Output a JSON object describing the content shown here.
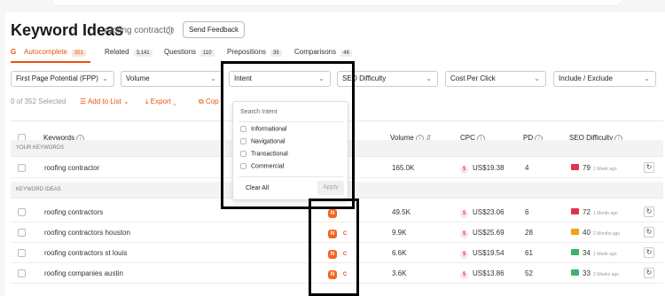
{
  "header": {
    "title": "Keyword Ideas",
    "subtitle": "roofing contractor",
    "feedback_label": "Send Feedback"
  },
  "tabs": [
    {
      "label": "Autocomplete",
      "count": "351"
    },
    {
      "label": "Related",
      "count": "3,141"
    },
    {
      "label": "Questions",
      "count": "110"
    },
    {
      "label": "Prepositions",
      "count": "35"
    },
    {
      "label": "Comparisons",
      "count": "46"
    }
  ],
  "filters": {
    "fpp": "First Page Potential (FPP)",
    "volume": "Volume",
    "intent": "Intent",
    "seo": "SEO Difficulty",
    "cpc": "Cost Per Click",
    "include": "Include / Exclude"
  },
  "actions": {
    "selected": "0 of 352 Selected",
    "add": "Add to List",
    "export": "Export",
    "copy": "Cop"
  },
  "table": {
    "headers": {
      "keywords": "Keywords",
      "volume": "Volume",
      "cpc": "CPC",
      "pd": "PD",
      "seo": "SEO Difficulty"
    },
    "your_keywords_label": "YOUR KEYWORDS",
    "keyword_ideas_label": "KEYWORD IDEAS",
    "your_rows": [
      {
        "keyword": "roofing contractor",
        "volume": "165.0K",
        "cpc": "US$19.38",
        "pd": "4",
        "seo": "79",
        "ago": "1 Week ago",
        "seo_color": "#e0334f"
      }
    ],
    "idea_rows": [
      {
        "keyword": "roofing contractors",
        "intent": [
          "N"
        ],
        "volume": "49.5K",
        "cpc": "US$23.06",
        "pd": "6",
        "seo": "72",
        "ago": "1 Month ago",
        "seo_color": "#e0334f"
      },
      {
        "keyword": "roofing contractors houston",
        "intent": [
          "N",
          "C"
        ],
        "volume": "9.9K",
        "cpc": "US$25.69",
        "pd": "28",
        "seo": "40",
        "ago": "2 Months ago",
        "seo_color": "#f2a20c"
      },
      {
        "keyword": "roofing contractors st louis",
        "intent": [
          "N",
          "C"
        ],
        "volume": "6.6K",
        "cpc": "US$19.54",
        "pd": "61",
        "seo": "34",
        "ago": "1 Week ago",
        "seo_color": "#3bb36b"
      },
      {
        "keyword": "roofing companies austin",
        "intent": [
          "N",
          "C"
        ],
        "volume": "3.6K",
        "cpc": "US$13.86",
        "pd": "52",
        "seo": "33",
        "ago": "3 Weeks ago",
        "seo_color": "#3bb36b"
      }
    ]
  },
  "intent_dropdown": {
    "search_placeholder": "Search Intent",
    "options": [
      "Informational",
      "Navigational",
      "Transactional",
      "Commercial"
    ],
    "clear": "Clear All",
    "apply": "Apply"
  },
  "icons": {
    "cpc_icon": "dollar-icon",
    "refresh_icon": "refresh-icon",
    "google_icon": "google-icon"
  }
}
